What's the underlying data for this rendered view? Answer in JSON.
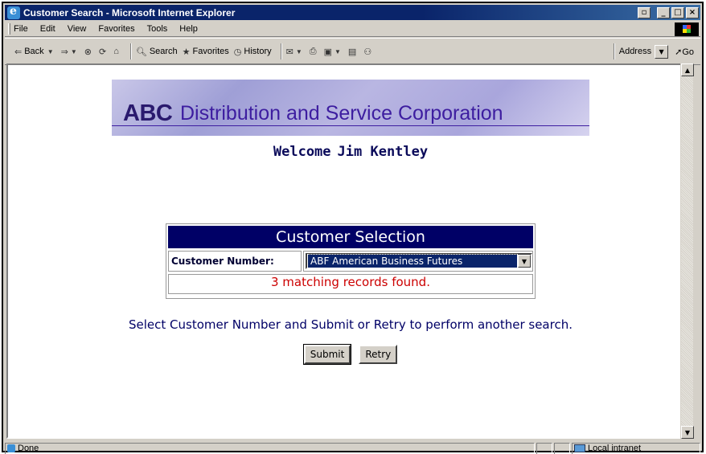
{
  "window": {
    "title": "Customer Search - Microsoft Internet Explorer"
  },
  "menu": {
    "items": [
      "File",
      "Edit",
      "View",
      "Favorites",
      "Tools",
      "Help"
    ]
  },
  "toolbar": {
    "back": "Back",
    "search": "Search",
    "favorites": "Favorites",
    "history": "History",
    "address_label": "Address",
    "go": "Go"
  },
  "page": {
    "banner_abc": "ABC",
    "banner_corp": "Distribution and Service Corporation",
    "welcome_word": "Welcome",
    "welcome_name": "Jim Kentley",
    "selection_title": "Customer Selection",
    "customer_number_label": "Customer Number:",
    "customer_selected": "ABF American Business Futures",
    "match_message": "3 matching records found.",
    "instruction": "Select Customer Number and Submit or Retry to perform another search.",
    "submit_label": "Submit",
    "retry_label": "Retry"
  },
  "status": {
    "text": "Done",
    "zone": "Local intranet"
  },
  "colors": {
    "header_bg": "#000066",
    "error_text": "#cc0000",
    "title_bar": "#0a246a"
  }
}
